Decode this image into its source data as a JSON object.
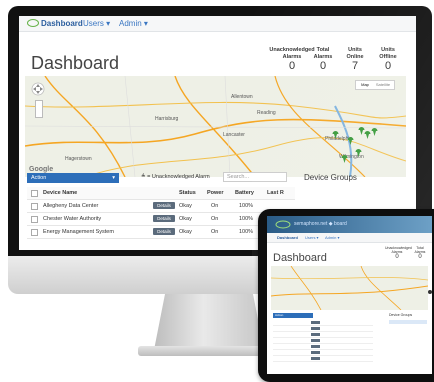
{
  "navbar": {
    "dashboard": "Dashboard",
    "users": "Users ▾",
    "admin": "Admin ▾"
  },
  "page_title": "Dashboard",
  "stats": [
    {
      "label": "Unacknowledged Alarms",
      "value": "0"
    },
    {
      "label": "Total Alarms",
      "value": "0"
    },
    {
      "label": "Units Online",
      "value": "7"
    },
    {
      "label": "Units Offline",
      "value": "0"
    }
  ],
  "map": {
    "toggle": [
      "Map",
      "Satellite"
    ],
    "watermark": "Google",
    "places": [
      "Allentown",
      "Harrisburg",
      "Reading",
      "Lancaster",
      "Philadelphia",
      "Wilmington",
      "Hagerstown"
    ],
    "marker_color": "#3a9a3a"
  },
  "toolbar": {
    "action_label": "Action",
    "filter_label": "≜ = Unacknowledged Alarm",
    "search_placeholder": "Search..."
  },
  "device_groups_title": "Device Groups",
  "table": {
    "headers": [
      "Device Name",
      "Status",
      "Power",
      "Battery",
      "Last R"
    ],
    "rows": [
      {
        "name": "Allegheny Data Center",
        "details": "Details",
        "status": "Okay",
        "power": "On",
        "battery": "100%"
      },
      {
        "name": "Chester Water Authority",
        "details": "Details",
        "status": "Okay",
        "power": "On",
        "battery": "100%"
      },
      {
        "name": "Energy Management System",
        "details": "Details",
        "status": "Okay",
        "power": "On",
        "battery": "100%"
      }
    ]
  },
  "tablet": {
    "brand": "semaphore.net  ◆  board",
    "nav": [
      "Dashboard",
      "Users ▾",
      "Admin ▾"
    ],
    "title": "Dashboard",
    "stats": [
      {
        "label": "Unacknowledged Alarms",
        "value": "0"
      },
      {
        "label": "Total Alarms",
        "value": "0"
      }
    ],
    "action_label": "Action",
    "groups_title": "Device Groups"
  }
}
